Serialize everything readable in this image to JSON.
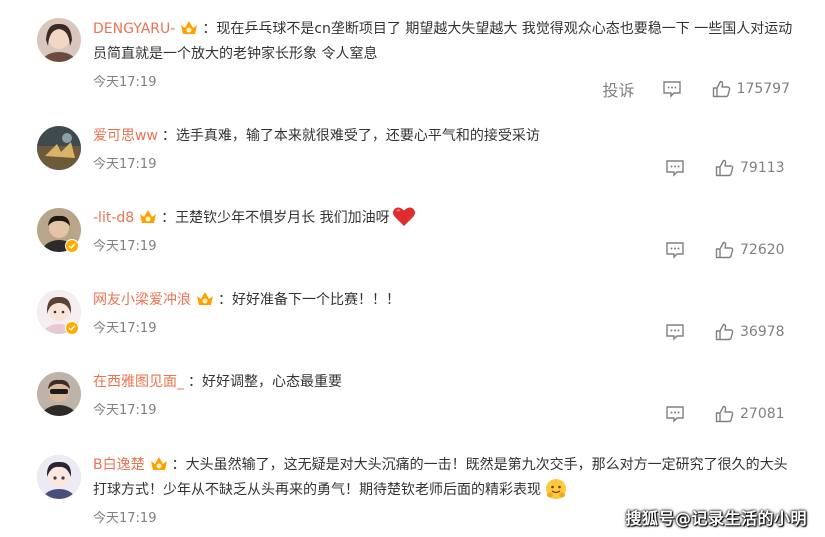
{
  "comments": [
    {
      "username": "DENGYARU-",
      "has_crown": true,
      "text": "现在乒乓球不是cn垄断项目了 期望越大失望越大 我觉得观众心态也要稳一下 一些国人对运动员简直就是一个放大的老钟家长形象 令人窒息",
      "time": "今天17:19",
      "report": "投诉",
      "likes": "175797"
    },
    {
      "username": "爱可思ww",
      "has_crown": false,
      "text": "选手真难，输了本来就很难受了，还要心平气和的接受采访",
      "time": "今天17:19",
      "likes": "79113"
    },
    {
      "username": "-lit-d8",
      "has_crown": true,
      "text": "王楚钦少年不惧岁月长 我们加油呀",
      "time": "今天17:19",
      "likes": "72620"
    },
    {
      "username": "网友小梁爱冲浪",
      "has_crown": true,
      "text": "好好准备下一个比赛！！！",
      "time": "今天17:19",
      "likes": "36978"
    },
    {
      "username": "在西雅图见面_",
      "has_crown": false,
      "text": "好好调整，心态最重要",
      "time": "今天17:19",
      "likes": "27081"
    },
    {
      "username": "B白逸楚",
      "has_crown": true,
      "text": "大头虽然输了，这无疑是对大头沉痛的一击！既然是第九次交手，那么对方一定研究了很久的大头打球方式！少年从不缺乏从头再来的勇气！期待楚钦老师后面的精彩表现",
      "time": "今天17:19"
    }
  ],
  "separator": "：",
  "watermark": "搜狐号@记录生活的小明",
  "colors": {
    "username": "#eb7350",
    "text": "#333333",
    "meta": "#808080",
    "crown": "#ffa000",
    "verified": "#ffab00"
  }
}
